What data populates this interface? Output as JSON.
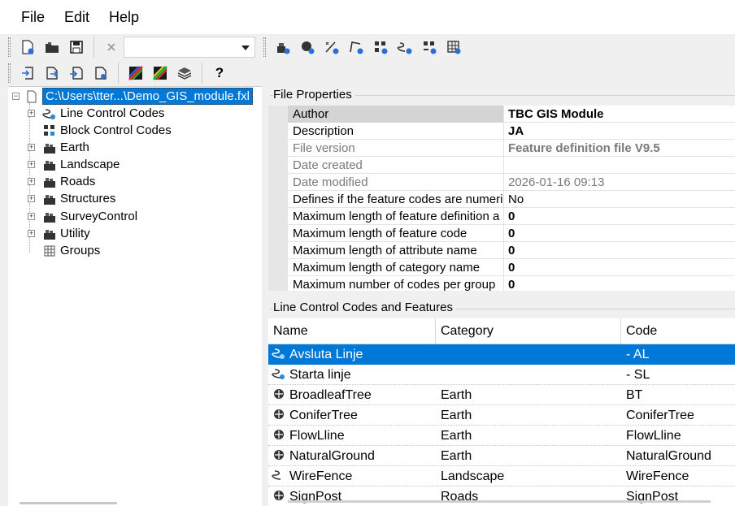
{
  "menu": [
    "File",
    "Edit",
    "Help"
  ],
  "toolbar": {
    "combo_value": "",
    "help_label": "?"
  },
  "tree": {
    "root": "C:\\Users\\tter...\\Demo_GIS_module.fxl",
    "items": [
      {
        "label": "Line Control Codes",
        "icon": "line-control-icon",
        "expandable": true
      },
      {
        "label": "Block Control Codes",
        "icon": "block-control-icon",
        "expandable": false
      },
      {
        "label": "Earth",
        "icon": "category-icon",
        "expandable": true
      },
      {
        "label": "Landscape",
        "icon": "category-icon",
        "expandable": true
      },
      {
        "label": "Roads",
        "icon": "category-icon",
        "expandable": true
      },
      {
        "label": "Structures",
        "icon": "category-icon",
        "expandable": true
      },
      {
        "label": "SurveyControl",
        "icon": "category-icon",
        "expandable": true
      },
      {
        "label": "Utility",
        "icon": "category-icon",
        "expandable": true
      },
      {
        "label": "Groups",
        "icon": "groups-icon",
        "expandable": false
      }
    ]
  },
  "file_properties": {
    "title": "File Properties",
    "rows": [
      {
        "name": "Author",
        "value": "TBC GIS Module",
        "style": "bold"
      },
      {
        "name": "Description",
        "value": "JA",
        "style": "bold"
      },
      {
        "name": "File version",
        "value": "Feature definition file V9.5",
        "style": "greybold"
      },
      {
        "name": "Date created",
        "value": "",
        "style": "grey"
      },
      {
        "name": "Date modified",
        "value": "2026-01-16 09:13",
        "style": "grey"
      },
      {
        "name": "Defines if the feature codes are numeri",
        "value": "No",
        "style": "normal"
      },
      {
        "name": "Maximum length of feature definition a",
        "value": "0",
        "style": "bold"
      },
      {
        "name": "Maximum length of feature code",
        "value": "0",
        "style": "bold"
      },
      {
        "name": "Maximum length of attribute name",
        "value": "0",
        "style": "bold"
      },
      {
        "name": "Maximum length of category name",
        "value": "0",
        "style": "bold"
      },
      {
        "name": "Maximum number of codes per group",
        "value": "0",
        "style": "bold"
      }
    ]
  },
  "codes_table": {
    "title": "Line Control Codes and Features",
    "columns": [
      "Name",
      "Category",
      "Code"
    ],
    "rows": [
      {
        "name": "Avsluta Linje",
        "category": "",
        "code": "- AL",
        "icon": "line-control-icon"
      },
      {
        "name": "Starta linje",
        "category": "",
        "code": "- SL",
        "icon": "line-control-icon"
      },
      {
        "name": "BroadleafTree",
        "category": "Earth",
        "code": "BT",
        "icon": "point-feature-icon"
      },
      {
        "name": "ConiferTree",
        "category": "Earth",
        "code": "ConiferTree",
        "icon": "point-feature-icon"
      },
      {
        "name": "FlowLline",
        "category": "Earth",
        "code": "FlowLline",
        "icon": "point-feature-icon"
      },
      {
        "name": "NaturalGround",
        "category": "Earth",
        "code": "NaturalGround",
        "icon": "point-feature-icon"
      },
      {
        "name": "WireFence",
        "category": "Landscape",
        "code": "WireFence",
        "icon": "line-feature-icon"
      },
      {
        "name": "SignPost",
        "category": "Roads",
        "code": "SignPost",
        "icon": "point-feature-icon"
      }
    ]
  }
}
